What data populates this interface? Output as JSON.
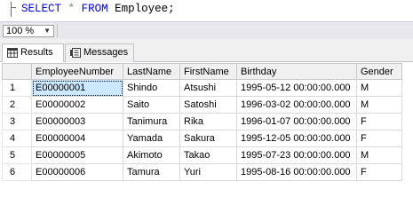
{
  "editor": {
    "keyword_select": "SELECT",
    "star": "*",
    "keyword_from": "FROM",
    "table_name": "Employee;"
  },
  "zoom": {
    "value": "100 %",
    "arrow": "▼"
  },
  "tabs": [
    {
      "label": "Results",
      "active": true,
      "icon": "grid-icon"
    },
    {
      "label": "Messages",
      "active": false,
      "icon": "messages-icon"
    }
  ],
  "grid": {
    "columns": [
      "",
      "EmployeeNumber",
      "LastName",
      "FirstName",
      "Birthday",
      "Gender"
    ],
    "rows": [
      [
        "1",
        "E00000001",
        "Shindo",
        "Atsushi",
        "1995-05-12 00:00:00.000",
        "M"
      ],
      [
        "2",
        "E00000002",
        "Saito",
        "Satoshi",
        "1996-03-02 00:00:00.000",
        "M"
      ],
      [
        "3",
        "E00000003",
        "Tanimura",
        "Rika",
        "1996-01-07 00:00:00.000",
        "F"
      ],
      [
        "4",
        "E00000004",
        "Yamada",
        "Sakura",
        "1995-12-05 00:00:00.000",
        "F"
      ],
      [
        "5",
        "E00000005",
        "Akimoto",
        "Takao",
        "1995-07-23 00:00:00.000",
        "M"
      ],
      [
        "6",
        "E00000006",
        "Tamura",
        "Yuri",
        "1995-08-16 00:00:00.000",
        "F"
      ]
    ],
    "selected_cell": {
      "row": 0,
      "col": 1
    }
  },
  "colors": {
    "keyword": "#0000ff",
    "selection": "#cce8ff"
  }
}
